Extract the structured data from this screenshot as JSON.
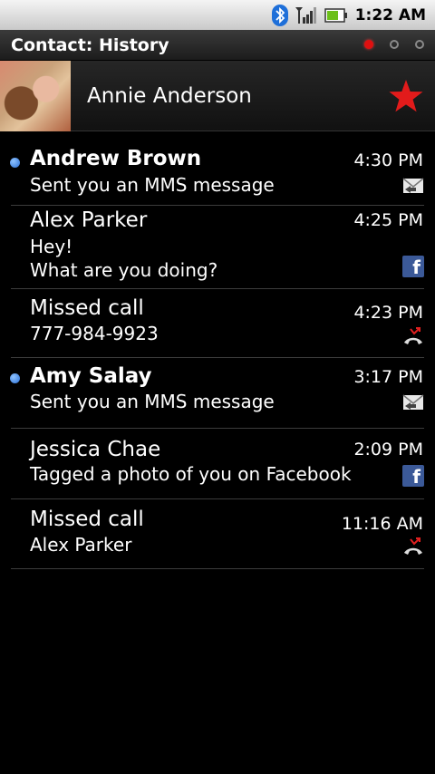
{
  "status_bar": {
    "time": "1:22 AM",
    "icons": [
      "bluetooth-icon",
      "signal-icon",
      "battery-icon"
    ]
  },
  "title_bar": {
    "title": "Contact: History",
    "page_indicator": {
      "total": 3,
      "active": 1
    }
  },
  "contact": {
    "name": "Annie Anderson",
    "favorite": true,
    "colors": {
      "star": "#e21b1b"
    }
  },
  "history": [
    {
      "title": "Andrew Brown",
      "lines": [
        "Sent you an MMS message"
      ],
      "time": "4:30 PM",
      "icon": "mms-icon",
      "unread": true
    },
    {
      "title": "Alex Parker",
      "lines": [
        "Hey!",
        "What are you doing?"
      ],
      "time": "4:25 PM",
      "icon": "facebook-icon",
      "unread": false
    },
    {
      "title": "Missed call",
      "lines": [
        "777-984-9923"
      ],
      "time": "4:23 PM",
      "icon": "missed-call-icon",
      "unread": false
    },
    {
      "title": "Amy Salay",
      "lines": [
        "Sent you an MMS message"
      ],
      "time": "3:17 PM",
      "icon": "mms-icon",
      "unread": true
    },
    {
      "title": "Jessica Chae",
      "lines": [
        "Tagged a photo of you on Facebook"
      ],
      "time": "2:09 PM",
      "icon": "facebook-icon",
      "unread": false
    },
    {
      "title": "Missed call",
      "lines": [
        "Alex Parker"
      ],
      "time": "11:16 AM",
      "icon": "missed-call-icon",
      "unread": false
    }
  ],
  "colors": {
    "unread_dot": "#3d86e6",
    "facebook": "#3b5998",
    "missed_call": "#e02020"
  }
}
